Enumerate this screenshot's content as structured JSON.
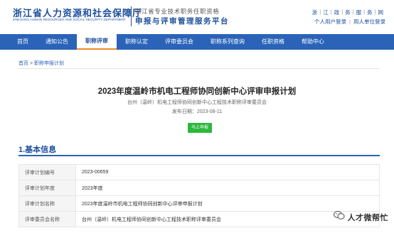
{
  "header": {
    "logo_cn": "浙江省人力资源和社会保障厅",
    "logo_en": "ZHEJIANG HUMAN RESOURCES AND SOCIAL SECURITY DEPARTMENT",
    "subtitle_small": "浙江省专业技术职务任职资格",
    "subtitle_big": "申报与评审管理服务平台",
    "region_links": [
      "浙",
      "江",
      "政",
      "务",
      "服",
      "务",
      "网"
    ],
    "login_link": "个人用户登录",
    "unit_login_link": "用人单位登录"
  },
  "nav": {
    "items": [
      "首页",
      "通知公告",
      "职称评审",
      "职称认定",
      "评审委员会",
      "职称系列查询",
      "任职资格",
      "帮助中心"
    ],
    "active_index": 2
  },
  "breadcrumb": {
    "home": "首页",
    "separator": ">",
    "current": "职称申报计划"
  },
  "plan": {
    "title": "2023年度温岭市机电工程师协同创新中心评审申报计划",
    "org": "台州（温岭）机电工程师协同创新中心工程技术职称评审委员会",
    "date": "发布日期：2023-08-11",
    "apply_button": "马上申报"
  },
  "section": {
    "title": "1.基本信息"
  },
  "info_rows": [
    {
      "label": "评审计划编号",
      "value": "2023-00659"
    },
    {
      "label": "评审计划年度",
      "value": "2023年度"
    },
    {
      "label": "评审计划名称",
      "value": "2023年度温岭市机电工程师协同创新中心评审申报计划"
    },
    {
      "label": "评审委员会名称",
      "value": "台州（温岭）机电工程师协同创新中心工程技术职称评审委员会"
    }
  ],
  "watermark": {
    "text": "人才微帮忙",
    "icon": "wechat-icon"
  },
  "colors": {
    "brand_blue": "#1c4f9c",
    "nav_blue": "#2a63b8",
    "active_underline": "#f08a24",
    "apply_green": "#2db83d"
  }
}
